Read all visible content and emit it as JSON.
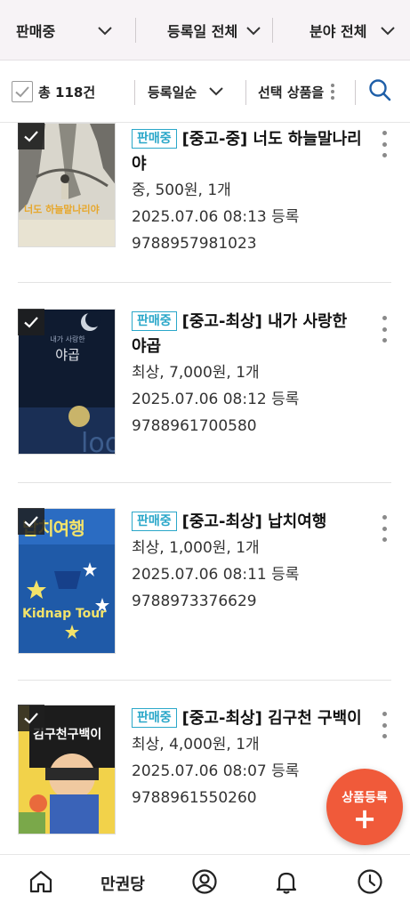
{
  "filters": {
    "status": "판매중",
    "date": "등록일 전체",
    "category": "분야 전체"
  },
  "toolbar": {
    "total": "총 118건",
    "sort": "등록일순",
    "bulk_action": "선택 상품을"
  },
  "items": [
    {
      "status_badge": "판매중",
      "title": "[중고-중] 너도 하늘말나리야",
      "condition_price": "중, 500원, 1개",
      "registered": "2025.07.06 08:13 등록",
      "isbn": "9788957981023",
      "cover_text": "너도 하늘말나리야"
    },
    {
      "status_badge": "판매중",
      "title": "[중고-최상] 내가 사랑한 야곱",
      "condition_price": "최상, 7,000원, 1개",
      "registered": "2025.07.06 08:12 등록",
      "isbn": "9788961700580",
      "cover_text": "야곱"
    },
    {
      "status_badge": "판매중",
      "title": "[중고-최상] 납치여행",
      "condition_price": "최상, 1,000원, 1개",
      "registered": "2025.07.06 08:11 등록",
      "isbn": "9788973376629",
      "cover_text": "납치여행",
      "cover_subtext": "Kidnap Tour"
    },
    {
      "status_badge": "판매중",
      "title": "[중고-최상] 김구천 구백이",
      "condition_price": "최상, 4,000원, 1개",
      "registered": "2025.07.06 08:07 등록",
      "isbn": "9788961550260",
      "cover_text": "김구천구백이"
    }
  ],
  "fab": {
    "label": "상품등록",
    "plus": "+"
  },
  "bottom_nav": {
    "home_icon": "home-icon",
    "brand": "만권당",
    "profile_icon": "user-circle-icon",
    "notification_icon": "bell-icon",
    "history_icon": "clock-icon"
  },
  "colors": {
    "accent": "#2aa7c9",
    "fab": "#f05a3a",
    "filter_bg": "#f7f3f6"
  }
}
